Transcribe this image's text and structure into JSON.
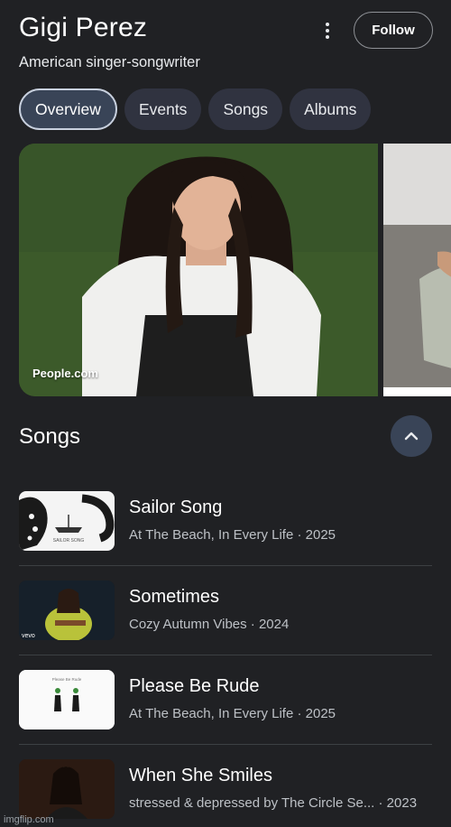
{
  "header": {
    "title": "Gigi Perez",
    "subtitle": "American singer-songwriter",
    "follow_label": "Follow",
    "more_icon": "more-vert-icon"
  },
  "tabs": [
    {
      "label": "Overview",
      "active": true
    },
    {
      "label": "Events",
      "active": false
    },
    {
      "label": "Songs",
      "active": false
    },
    {
      "label": "Albums",
      "active": false
    }
  ],
  "images": {
    "source": "People.com"
  },
  "songs_section": {
    "title": "Songs",
    "collapse_icon": "chevron-up-icon",
    "items": [
      {
        "title": "Sailor Song",
        "meta": "At The Beach, In Every Life · 2025",
        "thumb_text": "SAILOR SONG"
      },
      {
        "title": "Sometimes",
        "meta": "Cozy Autumn Vibes · 2024",
        "thumb_text": "vevo"
      },
      {
        "title": "Please Be Rude",
        "meta": "At The Beach, In Every Life · 2025",
        "thumb_text": "Please Be Rude"
      },
      {
        "title": "When She Smiles",
        "meta": "stressed & depressed by The Circle Se... · 2023",
        "thumb_text": ""
      }
    ]
  },
  "watermark": "imgflip.com",
  "colors": {
    "background": "#202124",
    "chip": "#303340",
    "chip_active": "#394457"
  }
}
